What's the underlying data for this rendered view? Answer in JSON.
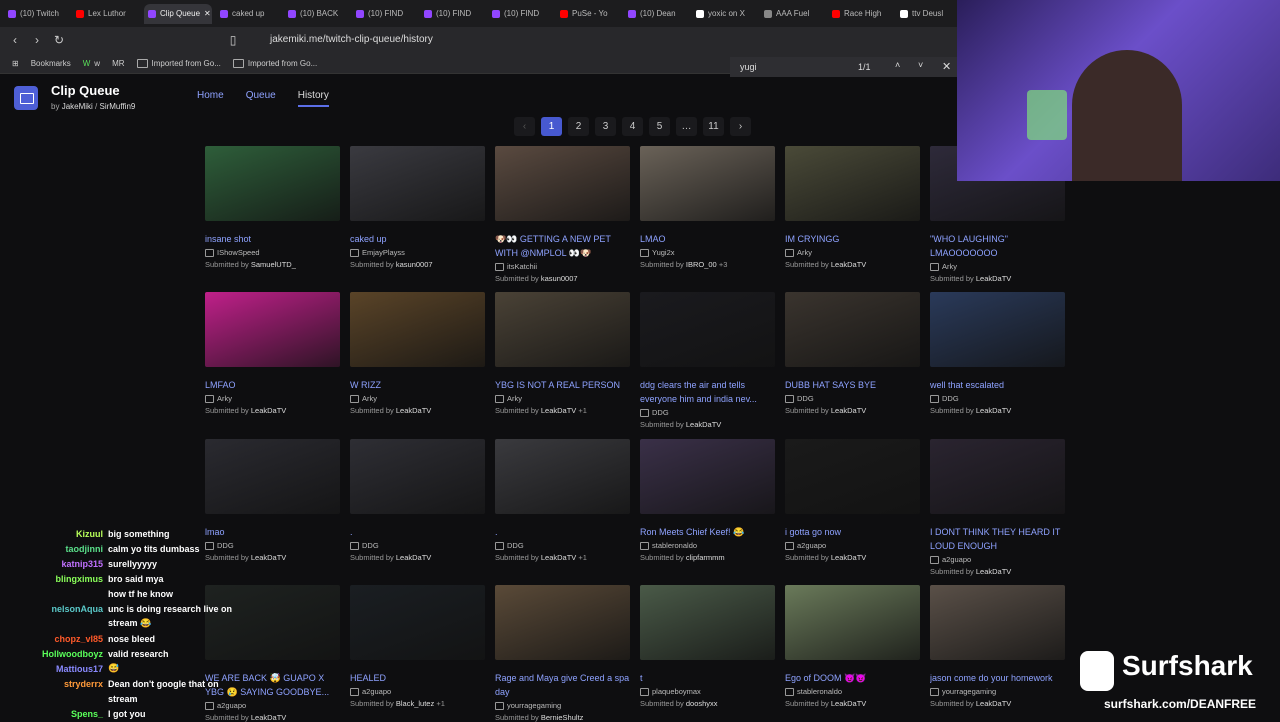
{
  "browser": {
    "tabs": [
      {
        "label": "(10) Twitch",
        "color": "#9146ff"
      },
      {
        "label": "Lex Luthor",
        "color": "#ff0000"
      },
      {
        "label": "Clip Queue",
        "color": "#9146ff"
      },
      {
        "label": "caked up",
        "color": "#9146ff"
      },
      {
        "label": "(10) BACK",
        "color": "#9146ff"
      },
      {
        "label": "(10) FIND",
        "color": "#9146ff"
      },
      {
        "label": "(10) FIND",
        "color": "#9146ff"
      },
      {
        "label": "(10) FIND",
        "color": "#9146ff"
      },
      {
        "label": "PuSe - Yo",
        "color": "#ff0000"
      },
      {
        "label": "(10) Dean",
        "color": "#9146ff"
      },
      {
        "label": "yoxic on X",
        "color": "#ffffff"
      },
      {
        "label": "AAA Fuel",
        "color": "#888888"
      },
      {
        "label": "Race High",
        "color": "#ff0000"
      },
      {
        "label": "ttv Deusl",
        "color": "#ffffff"
      }
    ],
    "url": "jakemiki.me/twitch-clip-queue/history",
    "bookmarks": [
      "Bookmarks",
      "w",
      "MR",
      "Imported from Go...",
      "Imported from Go..."
    ],
    "find": {
      "query": "yugi",
      "count": "1/1"
    }
  },
  "app": {
    "title": "Clip Queue",
    "by": "by",
    "author1": "JakeMiki",
    "author2": "SirMuffin9",
    "nav": [
      "Home",
      "Queue",
      "History"
    ]
  },
  "pager": [
    "‹",
    "1",
    "2",
    "3",
    "4",
    "5",
    "…",
    "11",
    "›"
  ],
  "clips": [
    {
      "title": "insane shot",
      "channel": "IShowSpeed",
      "sub": "SamuelUTD_",
      "extra": "",
      "thumb": "#2e5e3a"
    },
    {
      "title": "caked up",
      "channel": "EmjayPlayss",
      "sub": "kasun0007",
      "extra": "",
      "thumb": "#3a3a40"
    },
    {
      "title": "🐶👀 GETTING A NEW PET WITH @NMPLOL 👀🐶",
      "channel": "itsKatchii",
      "sub": "kasun0007",
      "extra": "",
      "thumb": "#5a4a40"
    },
    {
      "title": "LMAO",
      "channel": "Yugi2x",
      "sub": "IBRO_00",
      "extra": "+3",
      "thumb": "#6a6258"
    },
    {
      "title": "IM CRYINGG",
      "channel": "Arky",
      "sub": "LeakDaTV",
      "extra": "",
      "thumb": "#4a4a38"
    },
    {
      "title": "\"WHO LAUGHING\" LMAOOOOOOO",
      "channel": "Arky",
      "sub": "LeakDaTV",
      "extra": "",
      "thumb": "#2e2a3a"
    },
    {
      "title": "LMFAO",
      "channel": "Arky",
      "sub": "LeakDaTV",
      "extra": "",
      "thumb": "#c0208a"
    },
    {
      "title": "W RIZZ",
      "channel": "Arky",
      "sub": "LeakDaTV",
      "extra": "",
      "thumb": "#5a4428"
    },
    {
      "title": "YBG IS NOT A REAL PERSON",
      "channel": "Arky",
      "sub": "LeakDaTV",
      "extra": "+1",
      "thumb": "#4a4236"
    },
    {
      "title": "ddg clears the air and tells everyone him and india nev...",
      "channel": "DDG",
      "sub": "LeakDaTV",
      "extra": "",
      "thumb": "#1a1a1e"
    },
    {
      "title": "DUBB HAT SAYS BYE",
      "channel": "DDG",
      "sub": "LeakDaTV",
      "extra": "",
      "thumb": "#3a342e"
    },
    {
      "title": "well that escalated",
      "channel": "DDG",
      "sub": "LeakDaTV",
      "extra": "",
      "thumb": "#2a3a5a"
    },
    {
      "title": "lmao",
      "channel": "DDG",
      "sub": "LeakDaTV",
      "extra": "",
      "thumb": "#2a2a30"
    },
    {
      "title": ".",
      "channel": "DDG",
      "sub": "LeakDaTV",
      "extra": "",
      "thumb": "#2e2e34"
    },
    {
      "title": ".",
      "channel": "DDG",
      "sub": "LeakDaTV",
      "extra": "+1",
      "thumb": "#3a3a3e"
    },
    {
      "title": "Ron Meets Chief Keef! 😂",
      "channel": "stableronaldo",
      "sub": "clipfarmmm",
      "extra": "",
      "thumb": "#3a3048"
    },
    {
      "title": "i gotta go now",
      "channel": "a2guapo",
      "sub": "LeakDaTV",
      "extra": "",
      "thumb": "#1a1a1a"
    },
    {
      "title": "I DONT THINK THEY HEARD IT LOUD ENOUGH",
      "channel": "a2guapo",
      "sub": "LeakDaTV",
      "extra": "",
      "thumb": "#2a2430"
    },
    {
      "title": "WE ARE BACK 🤯 GUAPO X YBG 😢 SAYING GOODBYE...",
      "channel": "a2guapo",
      "sub": "LeakDaTV",
      "extra": "",
      "thumb": "#1e2220"
    },
    {
      "title": "HEALED",
      "channel": "a2guapo",
      "sub": "Black_lutez",
      "extra": "+1",
      "thumb": "#1a1e22"
    },
    {
      "title": "Rage and Maya give Creed a spa day",
      "channel": "yourragegaming",
      "sub": "BernieShultz",
      "extra": "",
      "thumb": "#5a4a38"
    },
    {
      "title": "t",
      "channel": "plaqueboymax",
      "sub": "dooshyxx",
      "extra": "",
      "thumb": "#4a5a48"
    },
    {
      "title": "Ego of DOOM 😈😈",
      "channel": "stableronaldo",
      "sub": "LeakDaTV",
      "extra": "",
      "thumb": "#6a7a5a"
    },
    {
      "title": "jason come do your homework",
      "channel": "yourragegaming",
      "sub": "LeakDaTV",
      "extra": "",
      "thumb": "#5a5048"
    }
  ],
  "submitted_by": "Submitted by",
  "chat": [
    {
      "user": "Kizuul",
      "text": "big something",
      "color": "#b8ff5a"
    },
    {
      "user": "taodjinni",
      "text": "calm yo tits dumbass",
      "color": "#5adf8a"
    },
    {
      "user": "katnip315",
      "text": "surellyyyyy",
      "color": "#c070ff"
    },
    {
      "user": "blingximus",
      "text": "bro said mya",
      "color": "#8aff5a"
    },
    {
      "user": "",
      "text": "how tf he know",
      "color": "#3a4aff"
    },
    {
      "user": "nelsonAqua",
      "text": "unc is doing research live on",
      "color": "#5ac8c8"
    },
    {
      "user": "",
      "text": "stream 😂",
      "color": "#ffffff"
    },
    {
      "user": "chopz_vl85",
      "text": "nose bleed",
      "color": "#ff5a2a"
    },
    {
      "user": "Hollwoodboyz",
      "text": "valid research",
      "color": "#5aff5a"
    },
    {
      "user": "Mattious17",
      "text": "😅",
      "color": "#8a8aff"
    },
    {
      "user": "stryderrx",
      "text": "Dean don't google that on",
      "color": "#ff9a3a"
    },
    {
      "user": "",
      "text": "stream",
      "color": "#ffffff"
    },
    {
      "user": "Spens_",
      "text": "I got you",
      "color": "#5aff5a"
    }
  ],
  "sponsor": {
    "name": "Surfshark",
    "url": "surfshark.com/DEANFREE"
  }
}
